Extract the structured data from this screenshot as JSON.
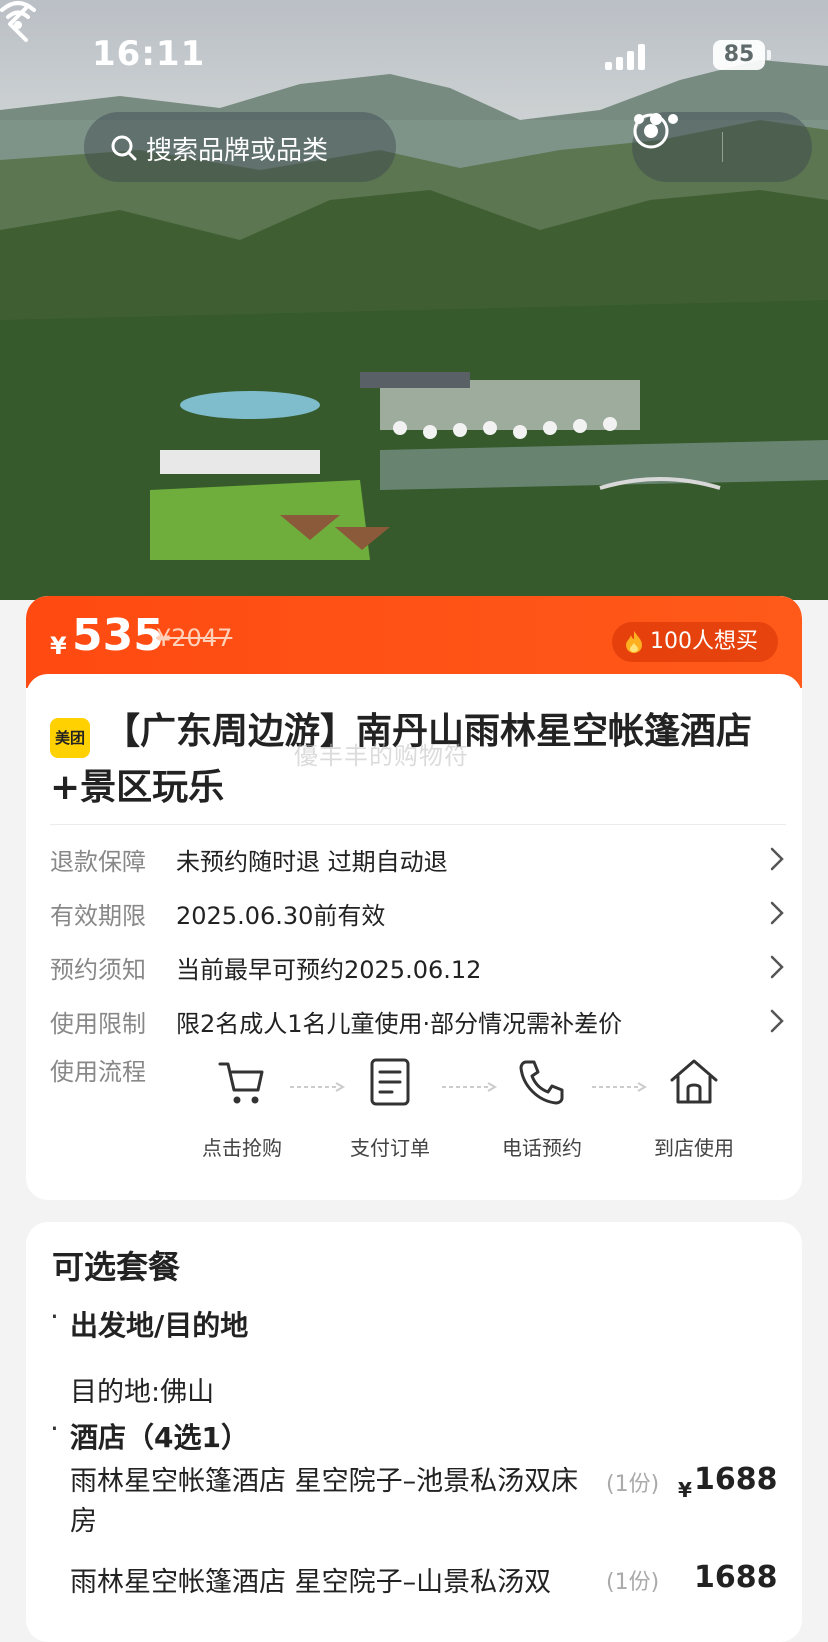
{
  "status_bar": {
    "time": "16:11",
    "battery": "85"
  },
  "nav": {
    "search_placeholder": "搜索品牌或品类"
  },
  "price": {
    "currency": "¥",
    "current": "535",
    "original": "¥2047",
    "want_badge": "100人想买"
  },
  "product": {
    "brand_logo": "美团",
    "title": "【广东周边游】南丹山雨林星空帐篷酒店+景区玩乐",
    "watermark": "優丰丰的购物符"
  },
  "info_rows": [
    {
      "key": "退款保障",
      "value": "未预约随时退 过期自动退"
    },
    {
      "key": "有效期限",
      "value": "2025.06.30前有效"
    },
    {
      "key": "预约须知",
      "value": "当前最早可预约2025.06.12"
    },
    {
      "key": "使用限制",
      "value": "限2名成人1名儿童使用·部分情况需补差价"
    }
  ],
  "flow": {
    "label": "使用流程",
    "steps": [
      {
        "label": "点击抢购",
        "icon": "cart-icon"
      },
      {
        "label": "支付订单",
        "icon": "document-icon"
      },
      {
        "label": "电话预约",
        "icon": "phone-icon"
      },
      {
        "label": "到店使用",
        "icon": "home-icon"
      }
    ]
  },
  "packages": {
    "title": "可选套餐",
    "sections": [
      {
        "heading": "出发地/目的地",
        "text": "目的地:佛山"
      },
      {
        "heading": "酒店（4选1）"
      }
    ],
    "items": [
      {
        "name": "雨林星空帐篷酒店 星空院子–池景私汤双床房",
        "qty": "(1份)",
        "currency": "¥",
        "price": "1688"
      },
      {
        "name": "雨林星空帐篷酒店 星空院子–山景私汤双",
        "qty": "(1份)",
        "price": "1688"
      }
    ]
  },
  "colors": {
    "accent": "#ff4a12",
    "brand_yellow": "#ffd100"
  }
}
